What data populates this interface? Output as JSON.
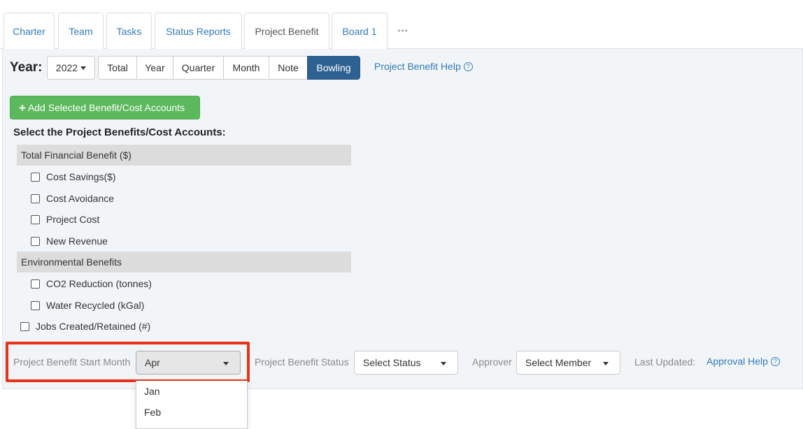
{
  "tabs": [
    {
      "label": "Charter"
    },
    {
      "label": "Team"
    },
    {
      "label": "Tasks"
    },
    {
      "label": "Status Reports"
    },
    {
      "label": "Project Benefit"
    },
    {
      "label": "Board 1"
    }
  ],
  "tabs_more": "•••",
  "active_tab": "Project Benefit",
  "toolbar": {
    "year_label": "Year:",
    "year_value": "2022",
    "views": [
      "Total",
      "Year",
      "Quarter",
      "Month",
      "Note",
      "Bowling"
    ],
    "active_view": "Bowling",
    "help_link": "Project Benefit Help",
    "help_icon": "?"
  },
  "add_button": {
    "plus": "+",
    "label": "Add Selected Benefit/Cost Accounts"
  },
  "section_title": "Select the Project Benefits/Cost Accounts:",
  "groups": [
    {
      "header": "Total Financial Benefit ($)",
      "items": [
        "Cost Savings($)",
        "Cost Avoidance",
        "Project Cost",
        "New Revenue"
      ]
    },
    {
      "header": "Environmental Benefits",
      "items": [
        "CO2 Reduction (tonnes)",
        "Water Recycled (kGal)"
      ]
    }
  ],
  "standalone_item": "Jobs Created/Retained (#)",
  "bottom": {
    "start_month_label": "Project Benefit Start Month",
    "start_month_value": "Apr",
    "status_label": "Project Benefit Status",
    "status_value": "Select Status",
    "approver_label": "Approver",
    "approver_value": "Select Member",
    "last_updated_label": "Last Updated:",
    "approval_help": "Approval Help",
    "approval_help_icon": "?"
  },
  "month_dropdown": {
    "visible_options": [
      "Jan",
      "Feb"
    ]
  },
  "colors": {
    "link": "#337ab7",
    "active_view": "#2e6193",
    "add_button": "#5cb85c",
    "highlight": "#e8331c",
    "panel": "#f2f5f8"
  }
}
